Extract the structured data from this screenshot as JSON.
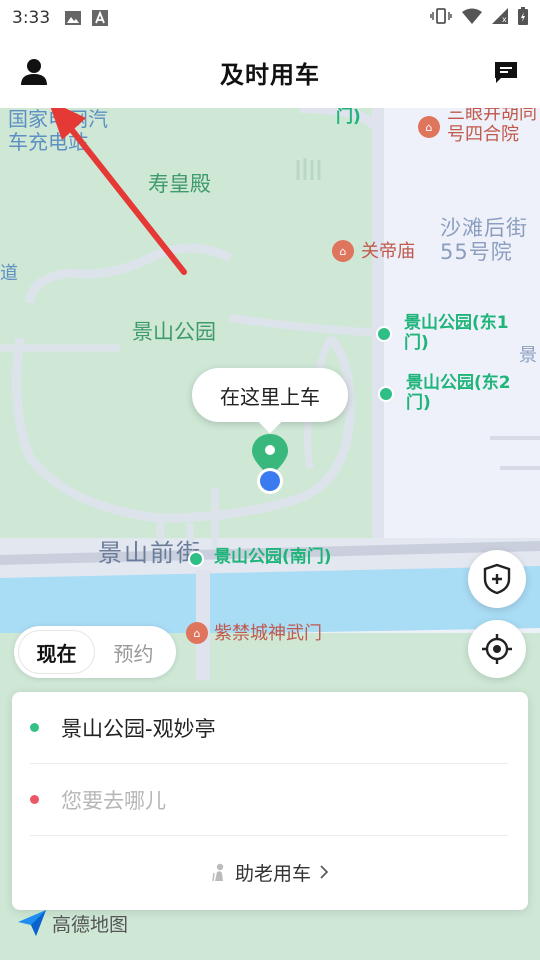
{
  "status_bar": {
    "time": "3:33"
  },
  "header": {
    "title": "及时用车"
  },
  "map": {
    "labels": {
      "charging_station": "国家电网汽\n车充电站",
      "shouhuang_hall": "寿皇殿",
      "sanyanjing": "三眼井胡同\n号四合院",
      "shatan": "沙滩后街\n55号院",
      "guandi_temple": "关帝庙",
      "jingshan_park": "景山公园",
      "east_gate_1": "景山公园(东1\n门)",
      "east_gate_2": "景山公园(东2\n门)",
      "south_gate": "景山公园(南门)",
      "jingshan_front_street": "景山前街",
      "shenwu_gate": "紫禁城神武门",
      "top_gate": "门)",
      "edge_left_char": "道",
      "edge_right_char": "景"
    },
    "pickup_bubble": "在这里上车",
    "attribution": "高德地图"
  },
  "toggle": {
    "now": "现在",
    "reserve": "预约",
    "selected": "now"
  },
  "route_card": {
    "pickup": "景山公园-观妙亭",
    "destination_placeholder": "您要去哪儿",
    "elder_label": "助老用车"
  },
  "colors": {
    "park_green": "#cfe8d6",
    "water_blue": "#a9dcf5",
    "pickup_pin": "#38b87c",
    "location_dot": "#3a7cf0",
    "annotation_arrow": "#e53935"
  }
}
